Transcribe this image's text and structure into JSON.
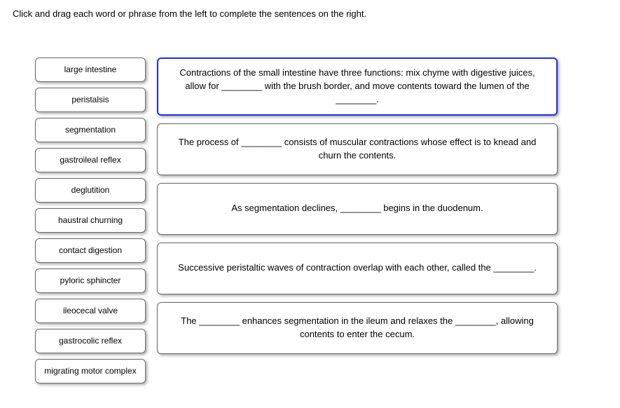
{
  "instructions": "Click and drag each word or phrase from the left to complete the sentences on the right.",
  "words": [
    "large intestine",
    "peristalsis",
    "segmentation",
    "gastroileal reflex",
    "deglutition",
    "haustral churning",
    "contact digestion",
    "pyloric sphincter",
    "ileocecal valve",
    "gastrocolic reflex",
    "migrating motor complex"
  ],
  "targets": [
    {
      "text": "Contractions of the small intestine have three functions: mix chyme with digestive juices, allow for ________ with the brush border, and move contents toward the lumen of the ________.",
      "active": true
    },
    {
      "text": "The process of ________ consists of muscular contractions whose effect is to knead and churn the contents.",
      "active": false
    },
    {
      "text": "As segmentation declines, ________ begins in the duodenum.",
      "active": false
    },
    {
      "text": "Successive peristaltic waves of contraction overlap with each other, called the ________.",
      "active": false
    },
    {
      "text": "The ________ enhances segmentation in the ileum and relaxes the ________, allowing contents to enter the cecum.",
      "active": false
    }
  ]
}
